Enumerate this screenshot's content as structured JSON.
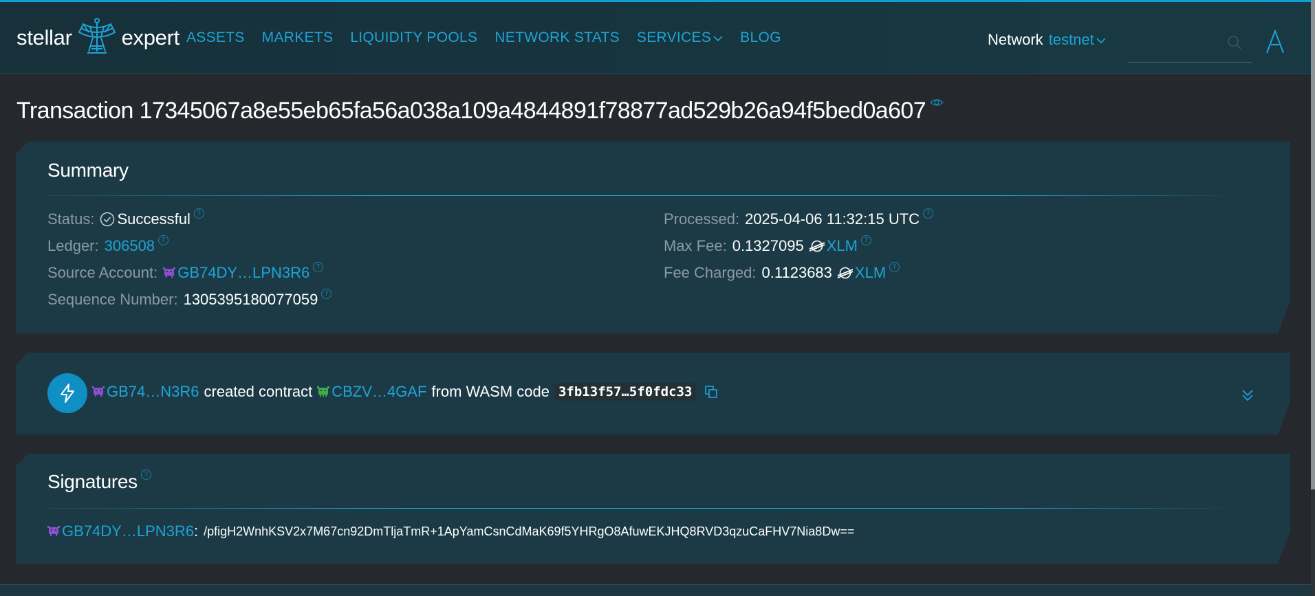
{
  "header": {
    "logo_left": "stellar",
    "logo_right": "expert",
    "nav": [
      "ASSETS",
      "MARKETS",
      "LIQUIDITY POOLS",
      "NETWORK STATS",
      "SERVICES",
      "BLOG"
    ],
    "network_label": "Network",
    "network_value": "testnet",
    "search_placeholder": ""
  },
  "page": {
    "title": "Transaction 17345067a8e55eb65fa56a038a109a4844891f78877ad529b26a94f5bed0a607"
  },
  "summary": {
    "title": "Summary",
    "status_label": "Status:",
    "status_value": "Successful",
    "ledger_label": "Ledger:",
    "ledger_value": "306508",
    "source_label": "Source Account:",
    "source_value": "GB74DY…LPN3R6",
    "sequence_label": "Sequence Number:",
    "sequence_value": "1305395180077059",
    "processed_label": "Processed:",
    "processed_value": "2025-04-06 11:32:15 UTC",
    "maxfee_label": "Max Fee:",
    "maxfee_value": "0.1327095",
    "maxfee_asset": "XLM",
    "feecharged_label": "Fee Charged:",
    "feecharged_value": "0.1123683",
    "feecharged_asset": "XLM"
  },
  "operation": {
    "account": "GB74…N3R6",
    "text1": "created contract",
    "contract": "CBZV…4GAF",
    "text2": "from WASM code",
    "code": "3fb13f57…5f0fdc33"
  },
  "signatures": {
    "title": "Signatures",
    "signer": "GB74DY…LPN3R6",
    "separator": ":",
    "signature": "/pfigH2WnhKSV2x7M67cn92DmTljaTmR+1ApYamCsnCdMaK69f5YHRgO8AfuwEKJHQ8RVD3qzuCaFHV7Nia8Dw=="
  },
  "colors": {
    "accent": "#1ea4d6",
    "background": "#25292d",
    "panel": "#1c3a45",
    "header": "#17303a"
  },
  "icons": {
    "logo": "satellite-dish-icon",
    "search": "search-icon",
    "profile": "profile-icon",
    "status": "check-circle-icon",
    "asset": "xlm-icon",
    "operation": "lightning-bolt-icon",
    "copy": "copy-icon",
    "expand": "chevron-double-down-icon"
  }
}
